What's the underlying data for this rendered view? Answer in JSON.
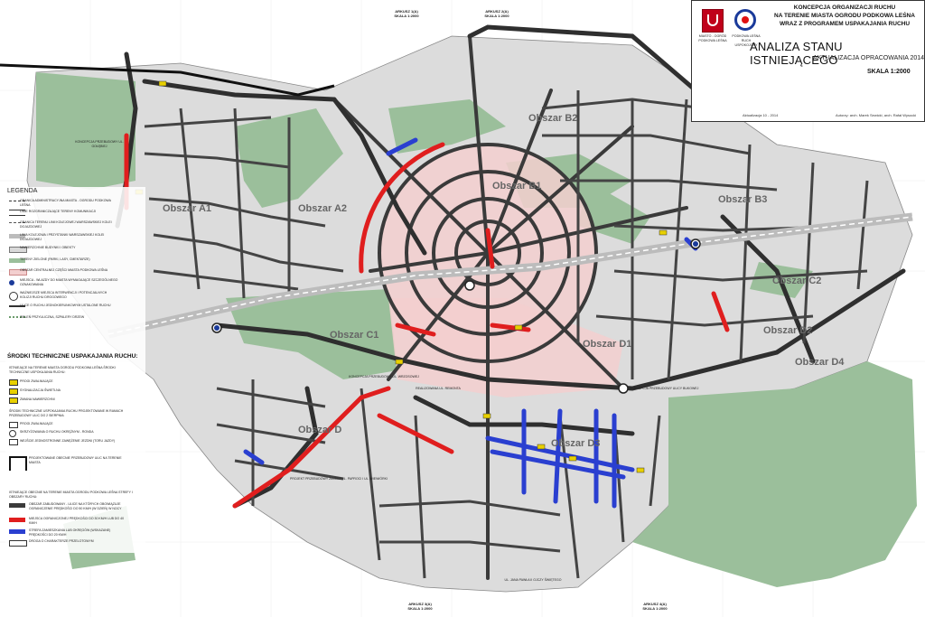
{
  "colors": {
    "background": "#ffffff",
    "green_area": "#8fb58f",
    "road": "#3a3a3a",
    "center_zone": "#f1cccc",
    "red_road": "#e01e1e",
    "blue_road": "#2a3fd0",
    "rail": "#bcbcbc",
    "block": "#d9d9d9"
  },
  "title_block": {
    "lines": [
      "KONCEPCJA ORGANIZACJI RUCHU",
      "NA TERENIE MIASTA OGRODU PODKOWA LEŚNA",
      "WRAZ Z PROGRAMEM USPAKAJANIA RUCHU"
    ],
    "main_title": "ANALIZA STANU ISTNIEJĄCEGO",
    "subtitle": "AKTUALIZACJA OPRACOWANIA 2014",
    "scale": "SKALA 1:2000",
    "logo1_caption": "MIASTO - OGRÓD\nPODKOWA LEŚNA",
    "logo2_caption": "PODKOWA LEŚNA\nRUCH USPOKOJONY",
    "logo1_icon": "podkowa-horseshoe-crest-icon",
    "logo2_icon": "traffic-calming-sign-icon",
    "date_note": "Aktualizacja 10 - 2014",
    "author": "Autorzy: arch. Marek Sewicki, arch. Rafał Wysocki"
  },
  "sheet_labels": {
    "top1": "ARKUSZ 1(A)\nSKALA 1:2000",
    "top2": "ARKUSZ 2(A)\nSKALA 1:2000",
    "bottom1": "ARKUSZ 3(A)\nSKALA 1:2000",
    "bottom2": "ARKUSZ 4(A)\nSKALA 1:2000"
  },
  "legend": {
    "title": "LEGENDA",
    "items": [
      "GRANICA ADMINISTRACYJNA MIASTA - OGRODU PODKOWA LEŚNA",
      "LINIE ROZGRANICZAJĄCE TERENY KOMUNIKACJI",
      "GRANICA TERENU LINII KOLEJOWEJ WARSZAWSKIEJ KOLEI DOJAZDOWEJ",
      "LINIA KOLEJOWA I PRZYSTANKI WARSZAWSKIEJ KOLEI DOJAZDOWEJ",
      "NAWIERZCHNIE BUDYNKI I OBIEKTY",
      "TERENY ZIELONE (PARKI, LASY, CMENTARZE)",
      "OBSZAR CENTRALNEJ CZĘŚCI MIASTA PODKOWA LEŚNA",
      "MIEJSCA - WLAZDY DO MIASTA WYMAGAJĄCE SZCZEGÓLNEGO OZNAKOWANIA",
      "WAŻNIEJSZE MIEJSCA INTERWENCJI I POTENCJALNYCH KOLIZJI RUCHU DROGOWEGO",
      "ULICE O RUCHU JEDNOKIERUNKOWYM USTALONE RUCHU",
      "ZIELEŃ PRZYULICZNA, SZPALERY DRZEW"
    ],
    "section_title": "ŚRODKI TECHNICZNE USPAKAJANIA RUCHU:",
    "measures_header": "ISTNIEJĄCE NA TERENIE MIASTA OGRODU PODKOWA LEŚNA ŚRODKI TECHNICZNE USPOKAJANIA RUCHU:",
    "measures": [
      "PROGI ZWALNIAJĄCE",
      "SYGNALIZACJA ŚWIETLNA",
      "ZMIANA NAWIERZCHNI"
    ],
    "planned_header": "ŚRODKI TECHNICZNE USPOKAJANIA RUCHU PROJEKTOWANE W RAMACH PRZEBUDOWY ULIC DO 2 SIERPNIA:",
    "planned": [
      "PROGI ZWALNIAJĄCE",
      "SKRZYŻOWANIA O RUCHU OKRĘŻNYM - RONDA",
      "WEJŚCIE JEDNOSTRONNE ZAWĘŻENIE JEZDNI (TORU JAZDY)"
    ],
    "project_note": "PROJEKTOWANE OBECNIE PRZEBUDOWY ULIC NA TERENIE MIASTA",
    "bottom_header": "ISTNIEJĄCE OBECNIE NA TERENIE MIASTA OGRODU PODKOWA LEŚNA STREFY I OBSZARY RUCHU:",
    "zones": [
      "OBSZAR ZABUDOWANY - ULICE NA KTÓRYCH OBOWIĄZUJE OGRANICZENIE PRĘDKOŚCI DO 50 KM/H (W DZIEŃ) W NOCY",
      "MIEJSCA OGRANICZONEJ PRĘDKOŚCI DO 30 KM/H LUB DO 40 KM/H",
      "STREFA ZAMIESZKANIA LUB OKRĘGÓW (WSKAZANE) PRĘDKOŚCI DO 20 KM/H",
      "DROGA O CHARAKTERZE PRZELOTOWYM"
    ]
  },
  "zones": [
    {
      "label": "Obszar A1"
    },
    {
      "label": "Obszar A2"
    },
    {
      "label": "Obszar C1"
    },
    {
      "label": "Obszar B1"
    },
    {
      "label": "Obszar B2"
    },
    {
      "label": "Obszar B3"
    },
    {
      "label": "Obszar C2"
    },
    {
      "label": "Obszar D1"
    },
    {
      "label": "Obszar D2"
    },
    {
      "label": "Obszar D3"
    },
    {
      "label": "Obszar D4"
    },
    {
      "label": "Obszar D"
    }
  ],
  "annotations": [
    "KONCEPCJA PRZEBUDOWY UL. GOŁĘBIEJ",
    "KONCEPCJA PRZEBUDOWY UL. WRZOSOWEJ",
    "KONCEPCJA PRZEBUDOWY ULICY BUKOWEJ",
    "PROJEKT PRZEBUDOWY ZIAGIEJ UL. PAPROCI I UL. WIEWIÓRKI",
    "REALIZOWANA UL. REMONTA",
    "UL. JANA PAWŁA II OJCZY ŚWIĘTEGO"
  ]
}
